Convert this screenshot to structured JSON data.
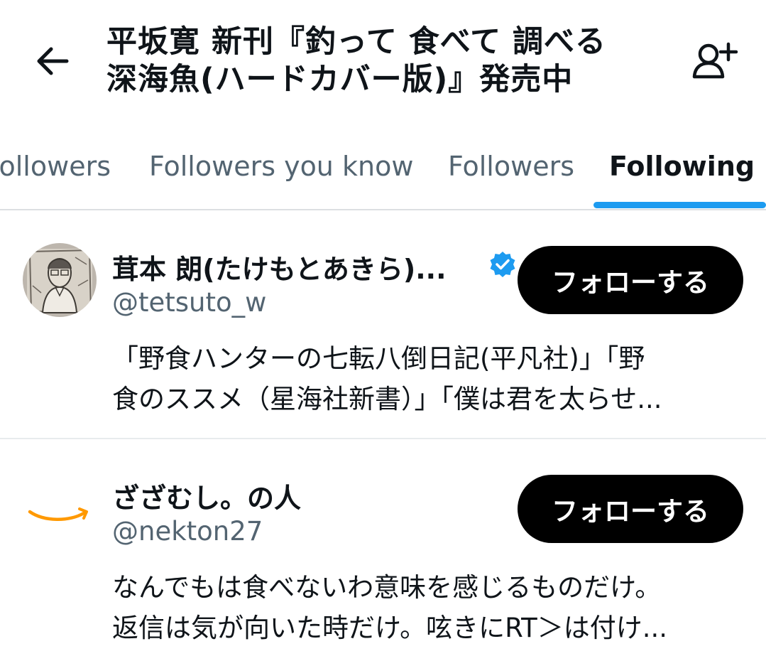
{
  "header": {
    "title_line1": "平坂寛 新刊『釣って 食べて 調べる",
    "title_line2": "深海魚(ハードカバー版)』発売中",
    "back_icon": "arrow-left-icon",
    "follow_icon": "person-add-icon"
  },
  "tabs": [
    {
      "label": "Followers",
      "active": false
    },
    {
      "label": "Followers you know",
      "active": false
    },
    {
      "label": "Followers",
      "active": false
    },
    {
      "label": "Following",
      "active": true
    }
  ],
  "users": [
    {
      "name": "茸本 朗(たけもとあきら)...",
      "handle": "@tetsuto_w",
      "verified": true,
      "button_label": "フォローする",
      "bio_line1": "「野食ハンターの七転八倒日記(平凡社)」「野",
      "bio_line2": "食のススメ（星海社新書）」「僕は君を太らせ..."
    },
    {
      "name": "ざざむし。の人",
      "handle": "@nekton27",
      "verified": false,
      "button_label": "フォローする",
      "bio_line1": "なんでもは食べないわ意味を感じるものだけ。",
      "bio_line2": "返信は気が向いた時だけ。呟きにRT＞は付け..."
    }
  ],
  "colors": {
    "accent": "#1d9bf0",
    "text_primary": "#0f1419",
    "text_secondary": "#536471",
    "button_bg": "#000000",
    "amazon_orange": "#ff9900"
  }
}
